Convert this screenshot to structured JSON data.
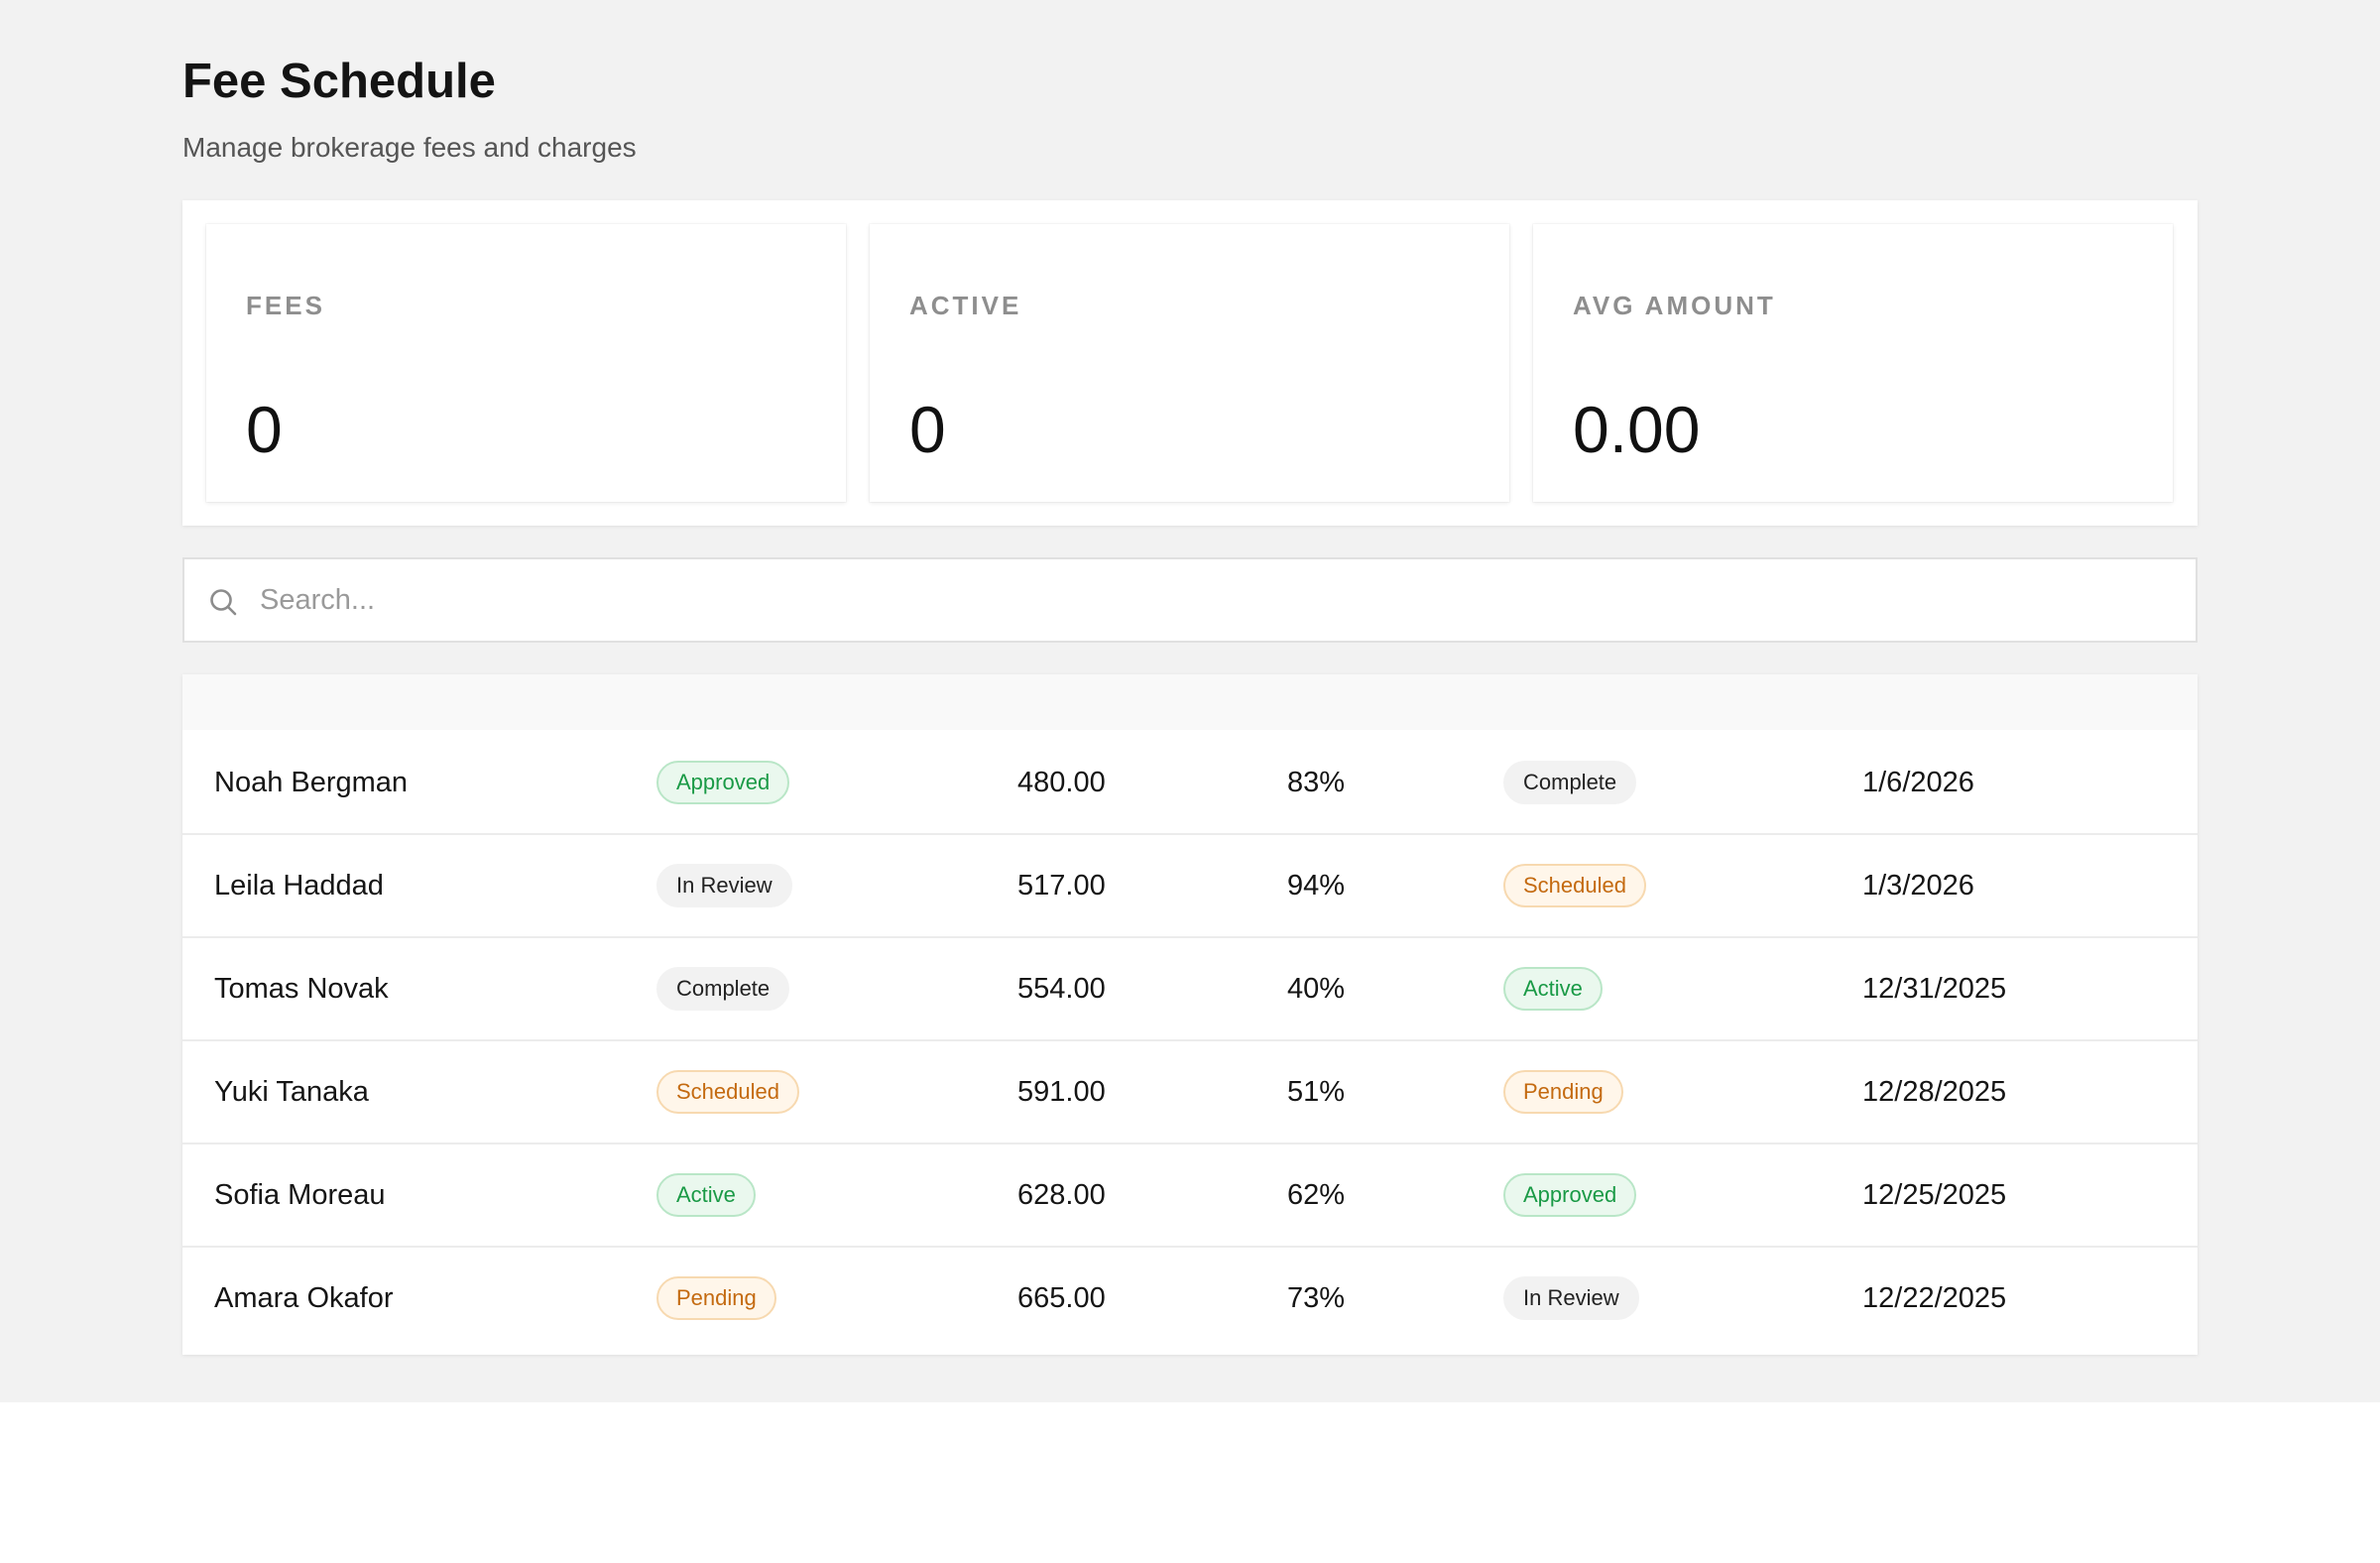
{
  "header": {
    "title": "Fee Schedule",
    "subtitle": "Manage brokerage fees and charges"
  },
  "stats": [
    {
      "label": "FEES",
      "value": "0"
    },
    {
      "label": "ACTIVE",
      "value": "0"
    },
    {
      "label": "AVG AMOUNT",
      "value": "0.00"
    }
  ],
  "search": {
    "placeholder": "Search...",
    "icon": "search-icon"
  },
  "colors": {
    "green_text": "#1a9a46",
    "green_bg": "#eaf8ee",
    "orange_text": "#c46a10",
    "orange_bg": "#fff6ea",
    "gray_bg": "#f2f2f2"
  },
  "table": {
    "rows": [
      {
        "name": "Noah Bergman",
        "status": "Approved",
        "status_tone": "green",
        "amount": "480.00",
        "percent": "83%",
        "state": "Complete",
        "state_tone": "gray",
        "date": "1/6/2026"
      },
      {
        "name": "Leila Haddad",
        "status": "In Review",
        "status_tone": "gray",
        "amount": "517.00",
        "percent": "94%",
        "state": "Scheduled",
        "state_tone": "orange",
        "date": "1/3/2026"
      },
      {
        "name": "Tomas Novak",
        "status": "Complete",
        "status_tone": "gray",
        "amount": "554.00",
        "percent": "40%",
        "state": "Active",
        "state_tone": "green",
        "date": "12/31/2025"
      },
      {
        "name": "Yuki Tanaka",
        "status": "Scheduled",
        "status_tone": "orange",
        "amount": "591.00",
        "percent": "51%",
        "state": "Pending",
        "state_tone": "orange",
        "date": "12/28/2025"
      },
      {
        "name": "Sofia Moreau",
        "status": "Active",
        "status_tone": "green",
        "amount": "628.00",
        "percent": "62%",
        "state": "Approved",
        "state_tone": "green",
        "date": "12/25/2025"
      },
      {
        "name": "Amara Okafor",
        "status": "Pending",
        "status_tone": "orange",
        "amount": "665.00",
        "percent": "73%",
        "state": "In Review",
        "state_tone": "gray",
        "date": "12/22/2025"
      }
    ]
  }
}
